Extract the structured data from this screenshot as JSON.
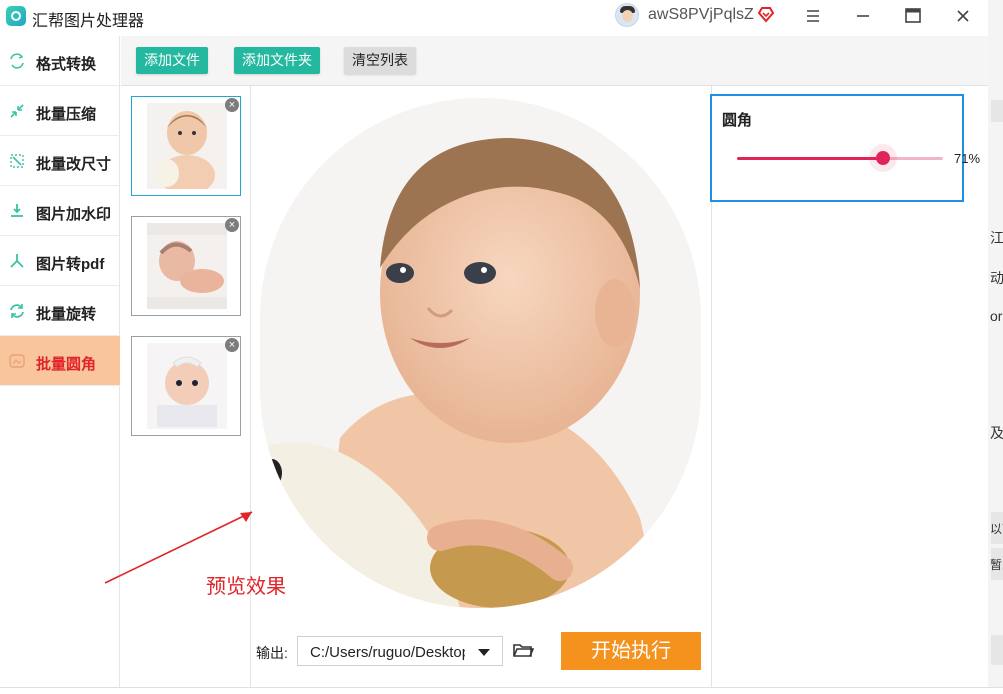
{
  "app": {
    "title": "汇帮图片处理器",
    "username": "awS8PVjPqlsZ"
  },
  "sidebar": {
    "items": [
      {
        "label": "格式转换",
        "icon": "format-convert-icon"
      },
      {
        "label": "批量压缩",
        "icon": "compress-icon"
      },
      {
        "label": "批量改尺寸",
        "icon": "resize-icon"
      },
      {
        "label": "图片加水印",
        "icon": "watermark-icon"
      },
      {
        "label": "图片转pdf",
        "icon": "pdf-icon"
      },
      {
        "label": "批量旋转",
        "icon": "rotate-icon"
      },
      {
        "label": "批量圆角",
        "icon": "rounded-corner-icon",
        "active": true
      }
    ]
  },
  "toolbar": {
    "add_file": "添加文件",
    "add_folder": "添加文件夹",
    "clear_list": "清空列表"
  },
  "thumbnails": [
    {
      "name": "baby-photo-1",
      "selected": true
    },
    {
      "name": "baby-photo-2",
      "selected": false
    },
    {
      "name": "baby-photo-3",
      "selected": false
    }
  ],
  "annotation": {
    "text": "预览效果"
  },
  "settings": {
    "title": "圆角",
    "value_label": "71%",
    "value": 0.71
  },
  "output": {
    "label": "输出:",
    "path": "C:/Users/ruguo/Desktop"
  },
  "start_button": "开始执行",
  "edge_fragments": [
    "江生",
    "动得",
    "or",
    "及",
    "以刻",
    "暂牙"
  ],
  "colors": {
    "accent_teal": "#25b8a0",
    "active_bg": "#f8c59c",
    "active_text": "#e0242a",
    "start_orange": "#f5921e",
    "slider": "#e0245a",
    "panel_border": "#1e90e6"
  }
}
